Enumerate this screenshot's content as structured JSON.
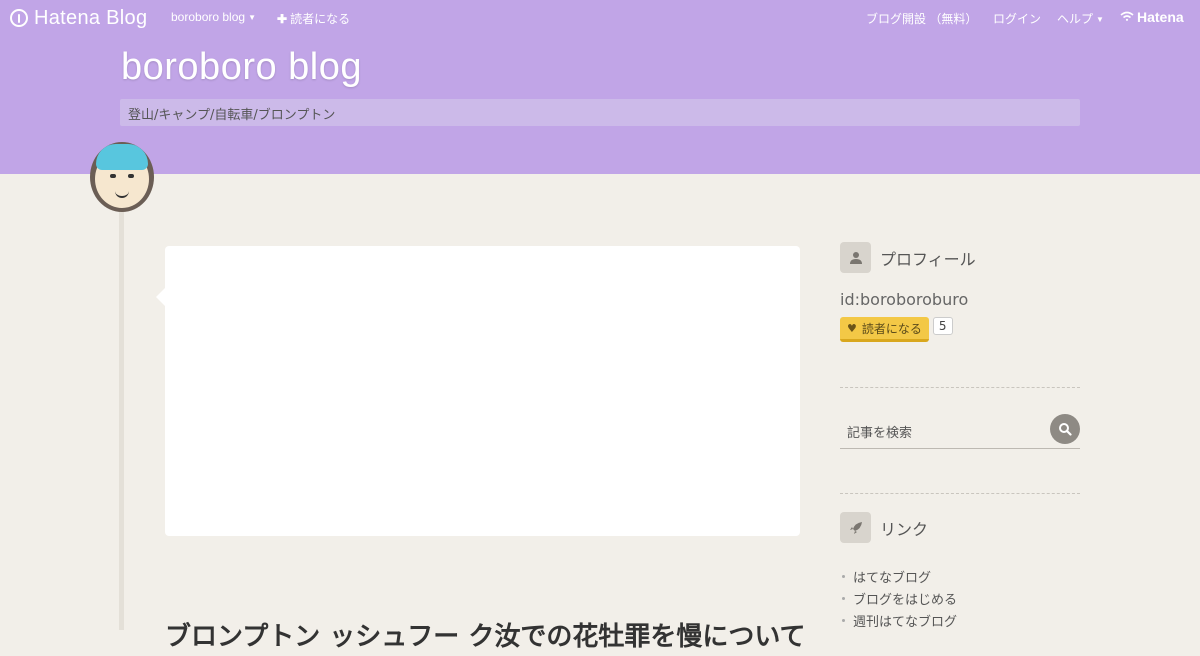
{
  "navbar": {
    "logo_text": "Hatena Blog",
    "blog_menu_label": "boroboro blog",
    "subscribe_label": "読者になる",
    "open_blog_label": "ブログ開設 （無料）",
    "login_label": "ログイン",
    "help_label": "ヘルプ",
    "brand_label": "Hatena"
  },
  "blog": {
    "title": "boroboro blog",
    "description": "登山/キャンプ/自転車/ブロンプトン"
  },
  "entry": {
    "title_partial": "ブロンプトン ッシュフー ク汝での花牡罪を慢について"
  },
  "sidebar": {
    "profile": {
      "heading": "プロフィール",
      "user_id": "id:boroboroburo",
      "subscribe_label": "読者になる",
      "subscriber_count": "5"
    },
    "search": {
      "placeholder": "記事を検索"
    },
    "links": {
      "heading": "リンク",
      "items": [
        "はてなブログ",
        "ブログをはじめる",
        "週刊はてなブログ"
      ]
    }
  },
  "colors": {
    "header_bg": "#c1a5e7",
    "page_bg": "#f2efe9",
    "subscribe_button": "#f3c846"
  },
  "icons": {
    "logo": "hatena-logo-icon",
    "profile": "user-icon",
    "search": "search-icon",
    "links": "rocket-icon"
  }
}
